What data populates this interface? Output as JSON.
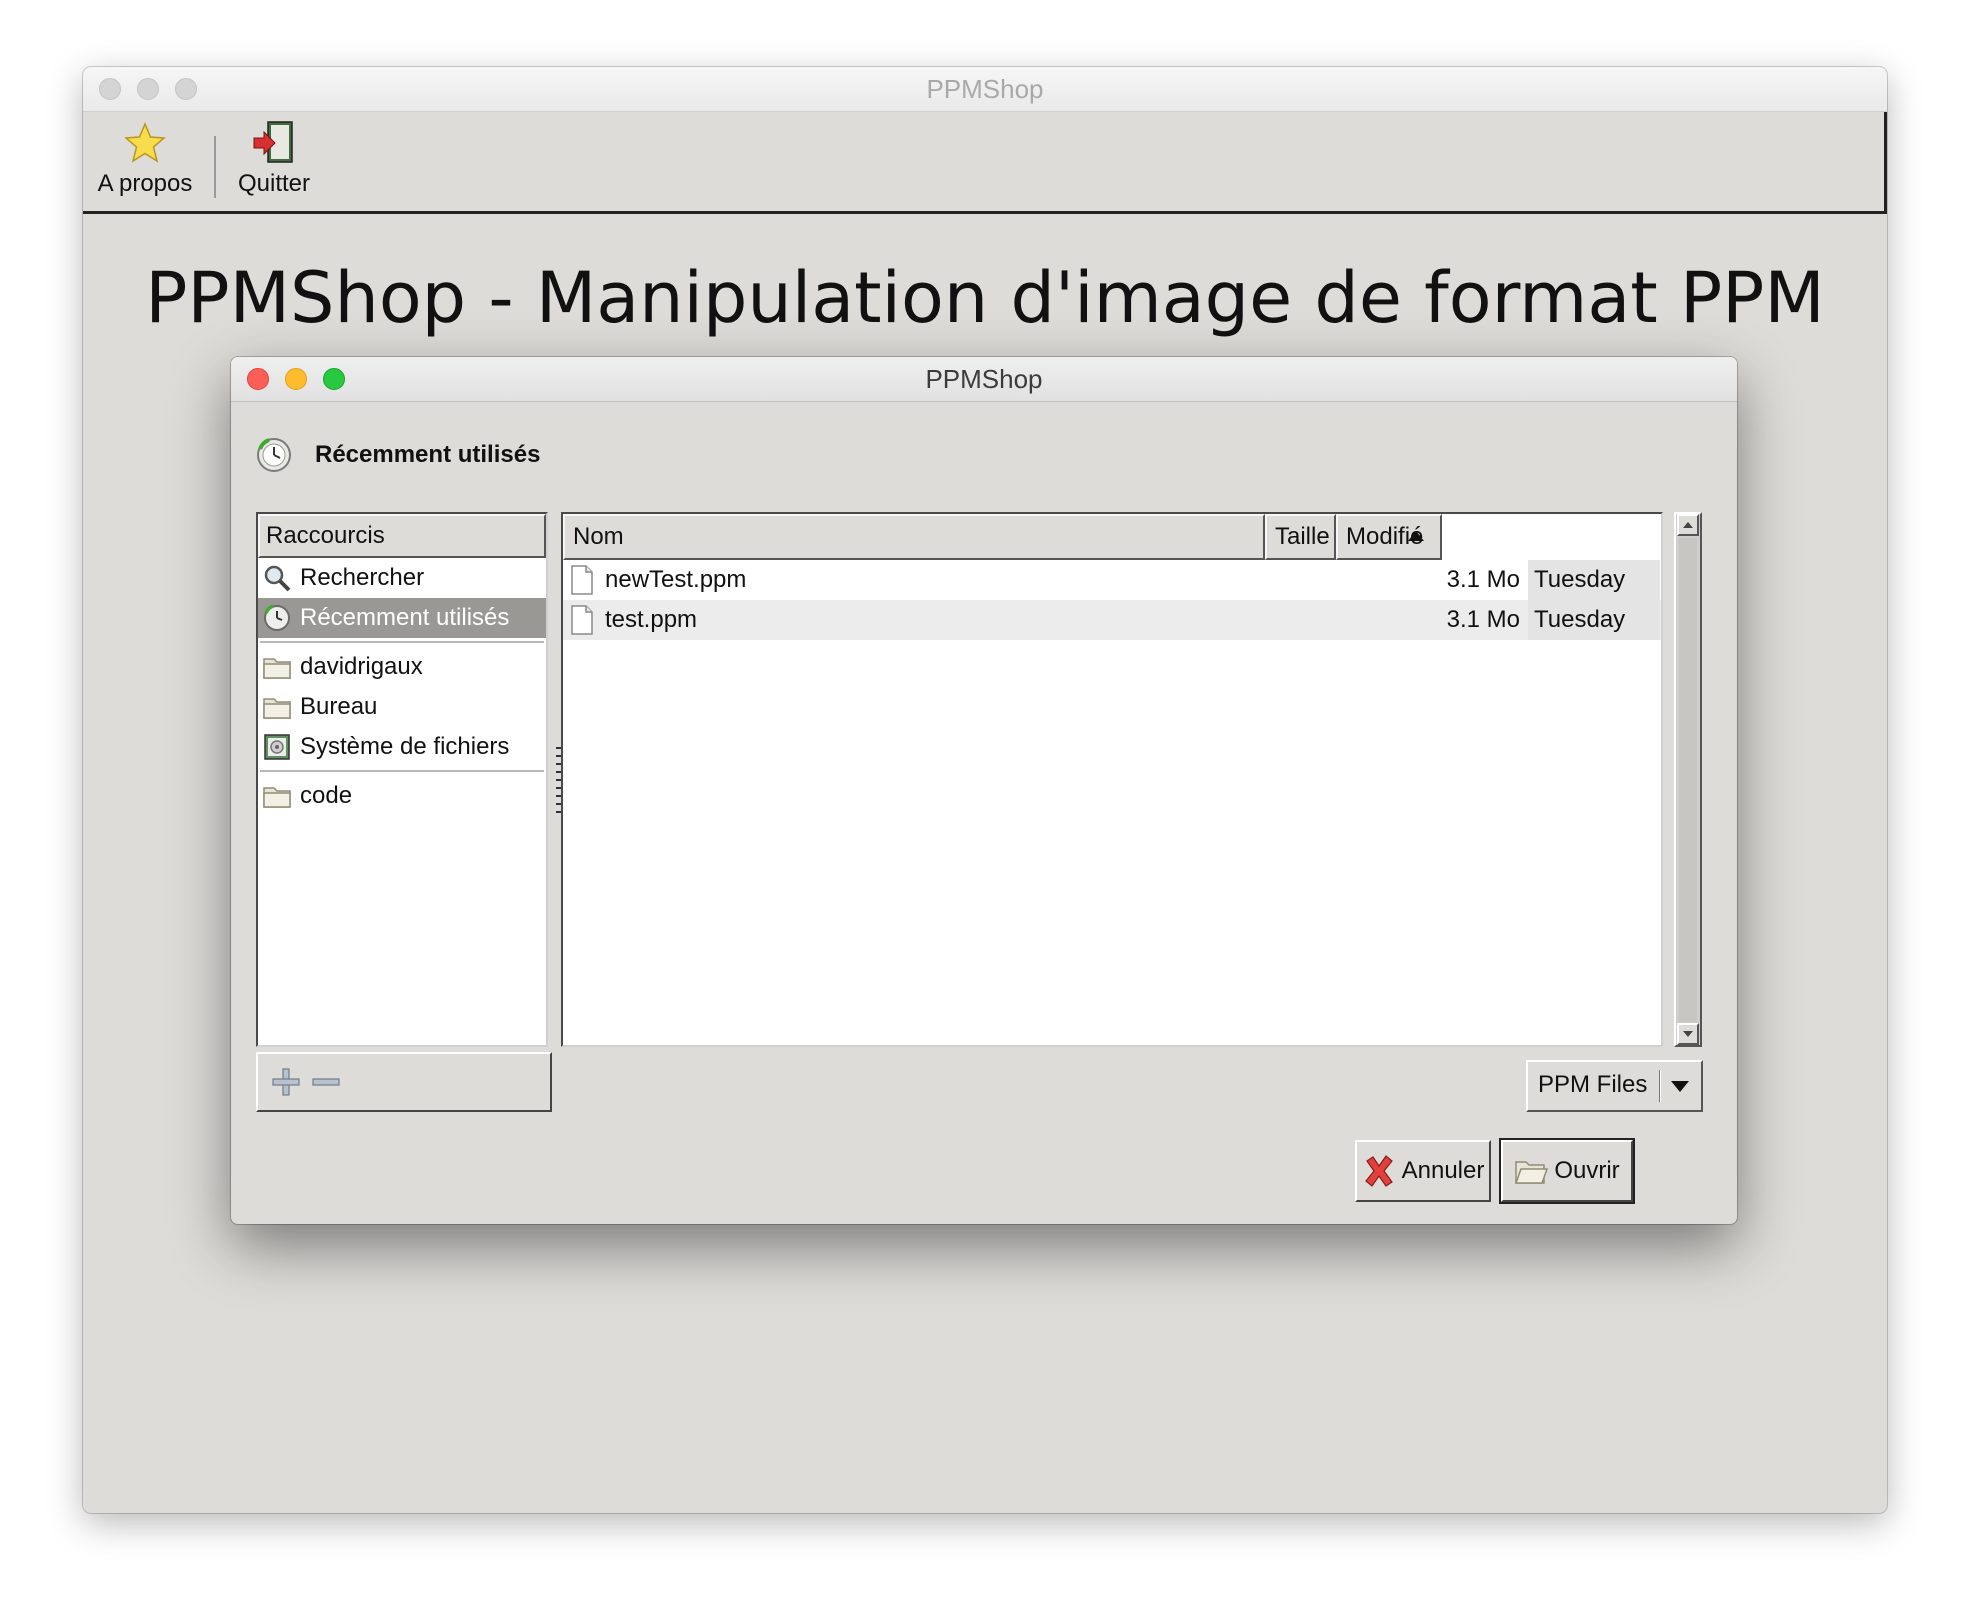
{
  "window": {
    "title": "PPMShop",
    "toolbar": [
      {
        "label": "A propos",
        "icon": "star-icon"
      },
      {
        "label": "Quitter",
        "icon": "exit-door-icon"
      }
    ],
    "heading": "PPMShop - Manipulation d'image de format PPM"
  },
  "dialog": {
    "title": "PPMShop",
    "location": {
      "label": "Récemment utilisés",
      "icon": "recent-clock-icon"
    },
    "shortcuts": {
      "header": "Raccourcis",
      "items": [
        {
          "label": "Rechercher",
          "icon": "search-icon"
        },
        {
          "label": "Récemment utilisés",
          "icon": "recent-clock-icon",
          "selected": true
        },
        {
          "label": "davidrigaux",
          "icon": "folder-icon"
        },
        {
          "label": "Bureau",
          "icon": "folder-icon"
        },
        {
          "label": "Système de fichiers",
          "icon": "drive-icon"
        },
        {
          "label": "code",
          "icon": "folder-icon"
        }
      ]
    },
    "files": {
      "columns": {
        "name": "Nom",
        "size": "Taille",
        "modified": "Modifié"
      },
      "sorted_by": "Modifié",
      "rows": [
        {
          "name": "newTest.ppm",
          "size": "3.1 Mo",
          "modified": "Tuesday"
        },
        {
          "name": "test.ppm",
          "size": "3.1 Mo",
          "modified": "Tuesday"
        }
      ]
    },
    "filter": {
      "selected": "PPM Files"
    },
    "buttons": {
      "cancel": "Annuler",
      "open": "Ouvrir"
    }
  }
}
